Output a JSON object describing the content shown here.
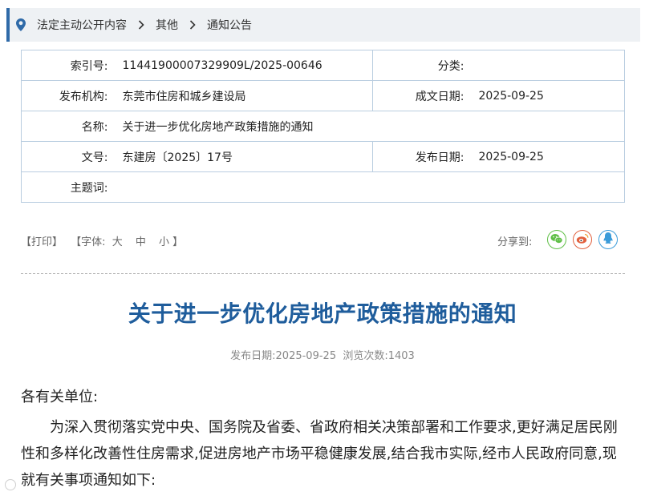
{
  "breadcrumb": {
    "items": [
      "法定主动公开内容",
      "其他",
      "通知公告"
    ],
    "icon": "location-pin-icon",
    "accent": "#2f6aa8"
  },
  "meta": {
    "index_label": "索引号:",
    "index_value": "11441900007329909L/2025-00646",
    "category_label": "分类:",
    "category_value": "",
    "publisher_label": "发布机构:",
    "publisher_value": "东莞市住房和城乡建设局",
    "written_date_label": "成文日期:",
    "written_date_value": "2025-09-25",
    "name_label": "名称:",
    "name_value": "关于进一步优化房地产政策措施的通知",
    "doc_no_label": "文号:",
    "doc_no_value": "东建房〔2025〕17号",
    "publish_date_label": "发布日期:",
    "publish_date_value": "2025-09-25",
    "keywords_label": "主题词:",
    "keywords_value": ""
  },
  "tools": {
    "print": "【打印】",
    "font_prefix": "【字体:",
    "font_large": "大",
    "font_medium": "中",
    "font_small": "小",
    "font_suffix": "】",
    "share_label": "分享到:"
  },
  "share_icons": [
    "wechat-icon",
    "weibo-icon",
    "qq-icon"
  ],
  "article": {
    "title": "关于进一步优化房地产政策措施的通知",
    "pubinfo": "发布日期:2025-09-25  浏览次数:1403",
    "salutation": "各有关单位:",
    "paragraph1": "为深入贯彻落实党中央、国务院及省委、省政府相关决策部署和工作要求,更好满足居民刚性和多样化改善性住房需求,促进房地产市场平稳健康发展,结合我市实际,经市人民政府同意,现就有关事项通知如下:",
    "title_color": "#1f5d9c"
  }
}
